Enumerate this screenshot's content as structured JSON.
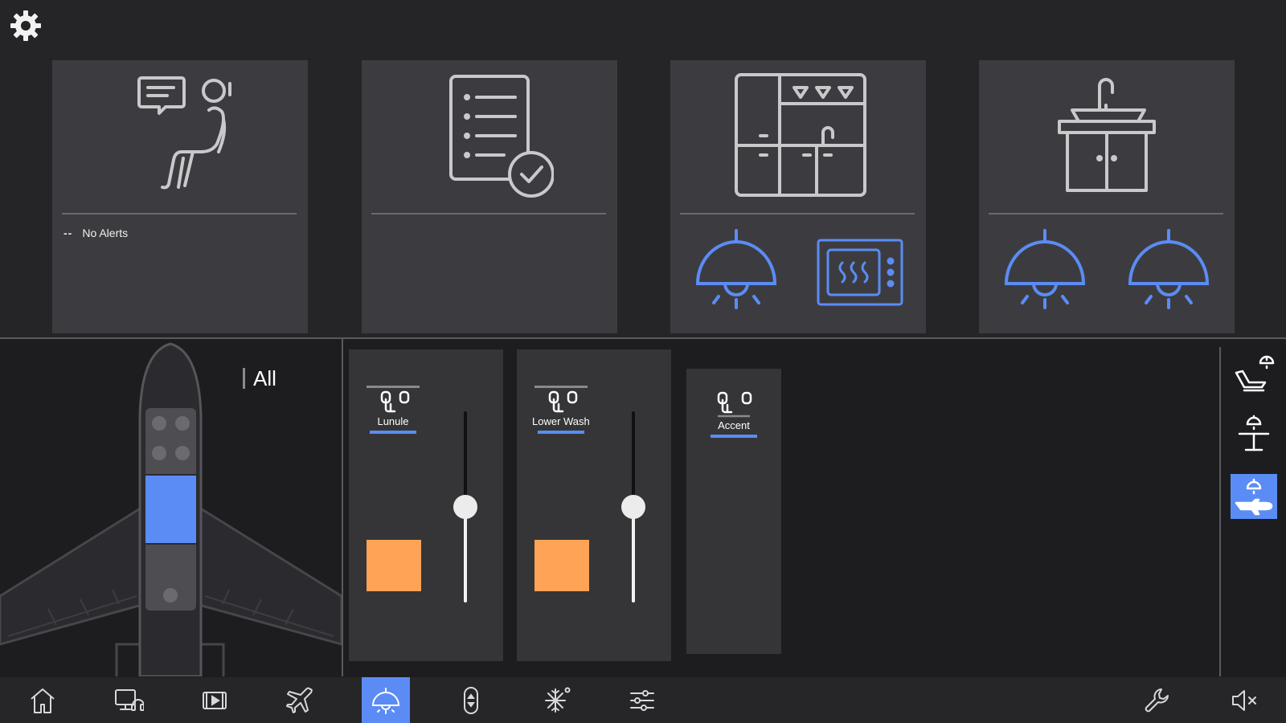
{
  "top_cards": [
    {
      "name": "passenger-alerts",
      "icon": "seat-chat-icon",
      "alert_marker": "--",
      "alert_text": "No Alerts"
    },
    {
      "name": "checklist",
      "icon": "checklist-icon"
    },
    {
      "name": "galley",
      "icon": "galley-icon",
      "controls": [
        "galley-light-icon",
        "oven-icon"
      ]
    },
    {
      "name": "lavatory",
      "icon": "sink-icon",
      "controls": [
        "lav-light-icon",
        "lav-light-2-icon"
      ]
    }
  ],
  "zone": {
    "label": "All"
  },
  "lights": [
    {
      "label": "Lunule",
      "level": 0.5,
      "color": "#ffa457"
    },
    {
      "label": "Lower Wash",
      "level": 0.5,
      "color": "#ffa457"
    },
    {
      "label": "Accent"
    }
  ],
  "side_controls": [
    "seat-light-icon",
    "table-light-icon",
    "cabin-light-icon"
  ],
  "nav_items": [
    "home-icon",
    "monitor-headset-icon",
    "media-icon",
    "flight-icon",
    "lighting-icon",
    "window-shade-icon",
    "climate-icon",
    "settings-sliders-icon",
    "wrench-icon",
    "mute-icon"
  ],
  "active_nav": "lighting-icon",
  "colors": {
    "accent": "#5b8cf5",
    "swatch": "#ffa457",
    "card": "#3c3c40"
  }
}
